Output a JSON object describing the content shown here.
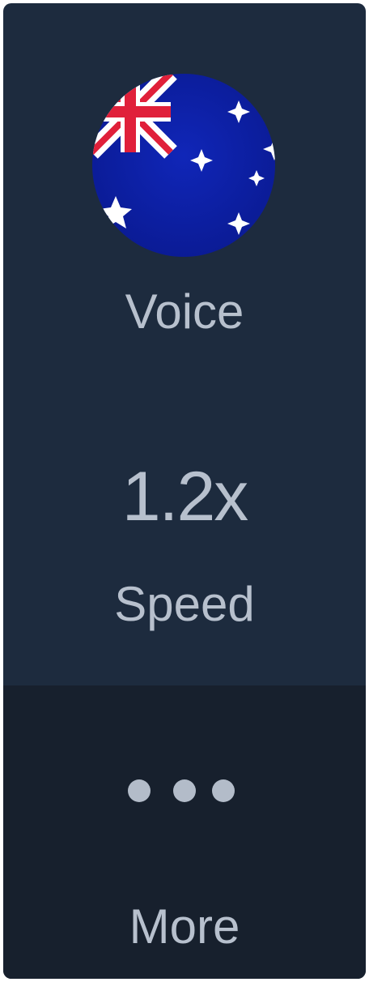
{
  "colors": {
    "panel_background": "#1d2b3e",
    "more_background": "#17202d",
    "text": "#b7c0cd",
    "flag_blue": "#0a1fa0",
    "flag_red": "#e0203a"
  },
  "voice": {
    "icon": "australia-flag-icon",
    "label": "Voice"
  },
  "speed": {
    "value": "1.2x",
    "label": "Speed"
  },
  "more": {
    "icon": "ellipsis-icon",
    "label": "More"
  }
}
